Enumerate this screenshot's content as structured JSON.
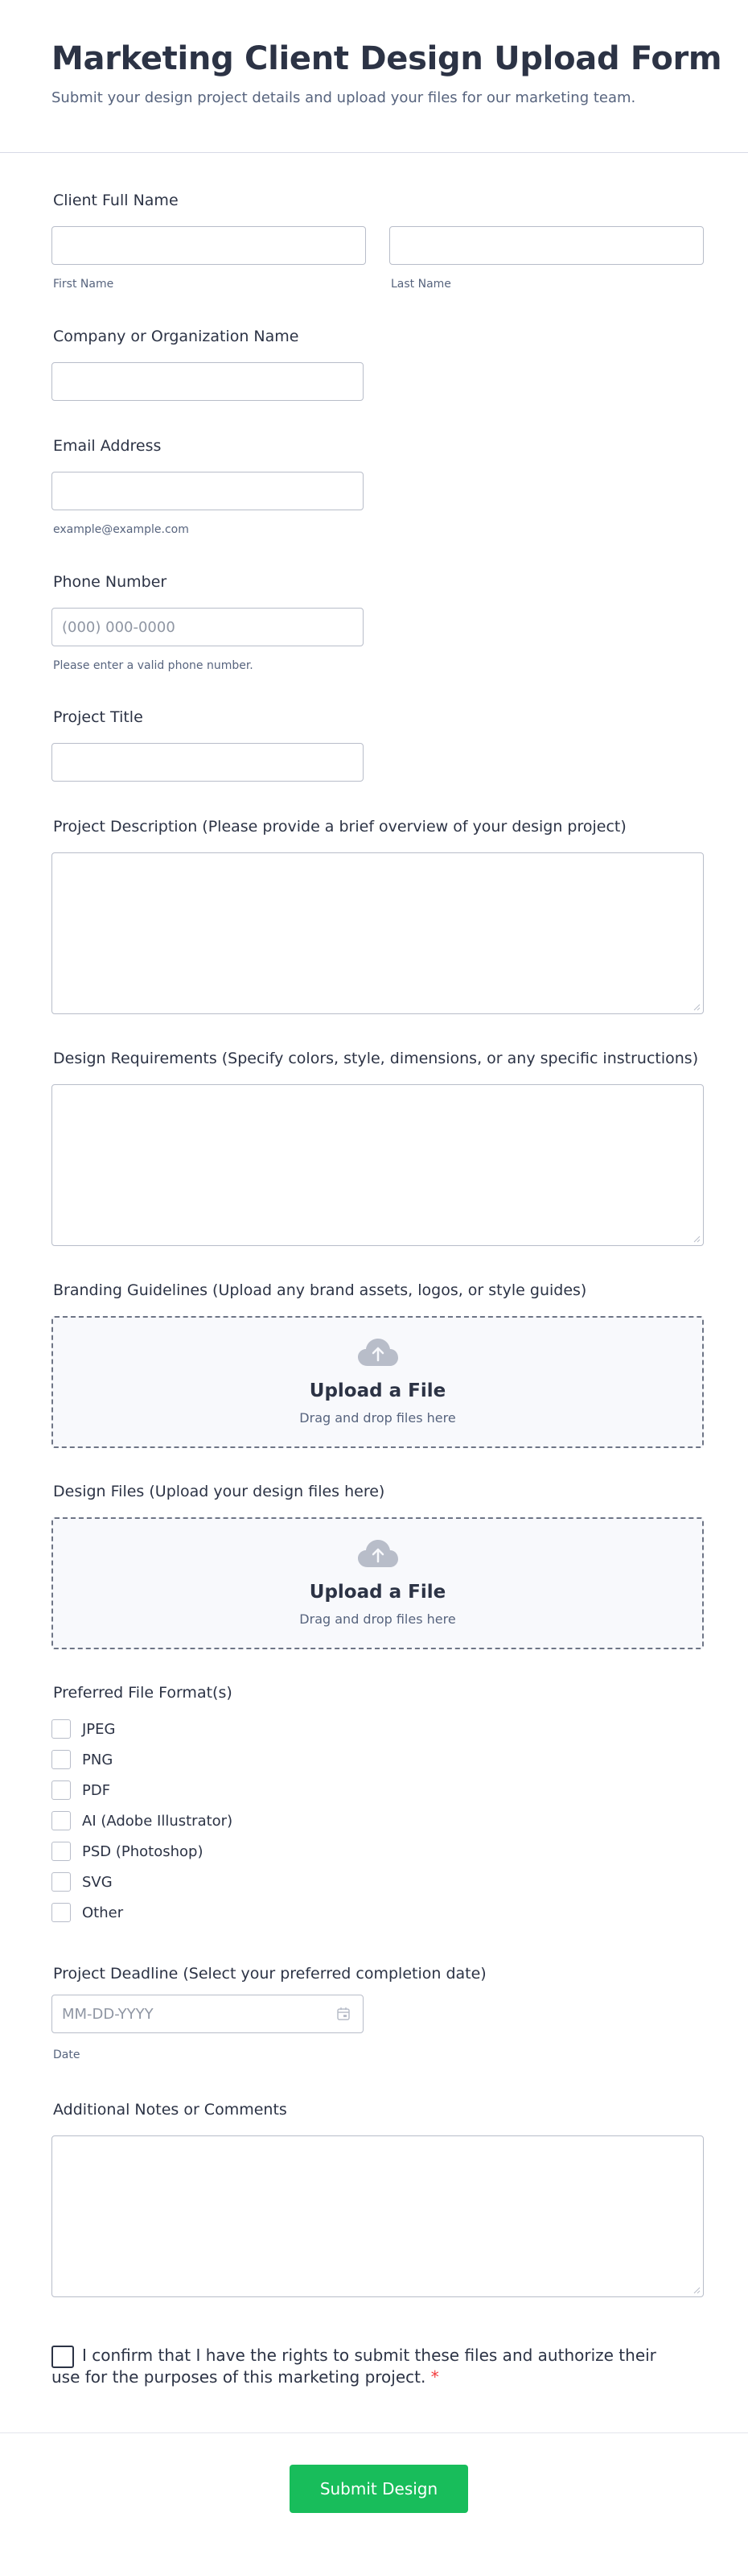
{
  "header": {
    "title": "Marketing Client Design Upload Form",
    "subtitle": "Submit your design project details and upload your files for our marketing team."
  },
  "fields": {
    "full_name": {
      "label": "Client Full Name",
      "first_sublabel": "First Name",
      "last_sublabel": "Last Name",
      "first_value": "",
      "last_value": ""
    },
    "company": {
      "label": "Company or Organization Name",
      "value": ""
    },
    "email": {
      "label": "Email Address",
      "sublabel": "example@example.com",
      "value": ""
    },
    "phone": {
      "label": "Phone Number",
      "placeholder": "(000) 000-0000",
      "sublabel": "Please enter a valid phone number.",
      "value": ""
    },
    "project_title": {
      "label": "Project Title",
      "value": ""
    },
    "description": {
      "label": "Project Description (Please provide a brief overview of your design project)",
      "value": ""
    },
    "requirements": {
      "label": "Design Requirements (Specify colors, style, dimensions, or any specific instructions)",
      "value": ""
    },
    "branding": {
      "label": "Branding Guidelines (Upload any brand assets, logos, or style guides)",
      "upload_title": "Upload a File",
      "upload_sub": "Drag and drop files here",
      "icon": "cloud-upload-icon"
    },
    "design_files": {
      "label": "Design Files (Upload your design files here)",
      "upload_title": "Upload a File",
      "upload_sub": "Drag and drop files here",
      "icon": "cloud-upload-icon"
    },
    "formats": {
      "label": "Preferred File Format(s)",
      "options": [
        "JPEG",
        "PNG",
        "PDF",
        "AI (Adobe Illustrator)",
        "PSD (Photoshop)",
        "SVG",
        "Other"
      ]
    },
    "deadline": {
      "label": "Project Deadline (Select your preferred completion date)",
      "placeholder": "MM-DD-YYYY",
      "sublabel": "Date",
      "icon": "calendar-icon"
    },
    "notes": {
      "label": "Additional Notes or Comments",
      "value": ""
    },
    "consent": {
      "line1": "I confirm that I have the rights to submit these files and authorize their",
      "line2": "use for the purposes of this marketing project.",
      "required_mark": "*"
    }
  },
  "footer": {
    "submit_label": "Submit Design"
  },
  "colors": {
    "accent": "#18bd5b",
    "text": "#2c3345",
    "muted": "#57647e",
    "required": "#f23a3c",
    "border": "#b8bdc9"
  }
}
